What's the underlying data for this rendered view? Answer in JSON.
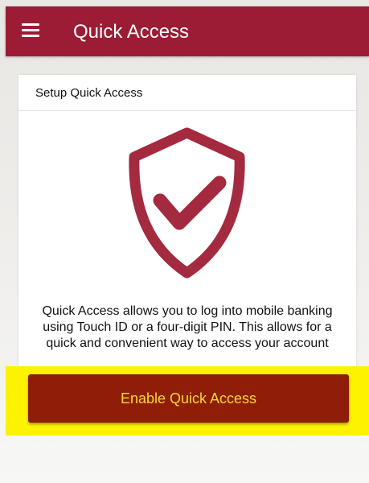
{
  "app_bar": {
    "title": "Quick Access",
    "color": "#9b1c34",
    "menu_icon": "hamburger-menu-icon"
  },
  "card": {
    "title": "Setup Quick Access",
    "icon": "shield-check-icon",
    "icon_color": "#a32a3f",
    "description": "Quick Access allows you to log into mobile banking using Touch ID or a four-digit PIN. This allows for a quick and convenient way to access your account"
  },
  "enable_button": {
    "label": "Enable Quick Access",
    "background": "#8e1e08",
    "text_color": "#f4d632",
    "highlight_color": "#fdf200"
  }
}
